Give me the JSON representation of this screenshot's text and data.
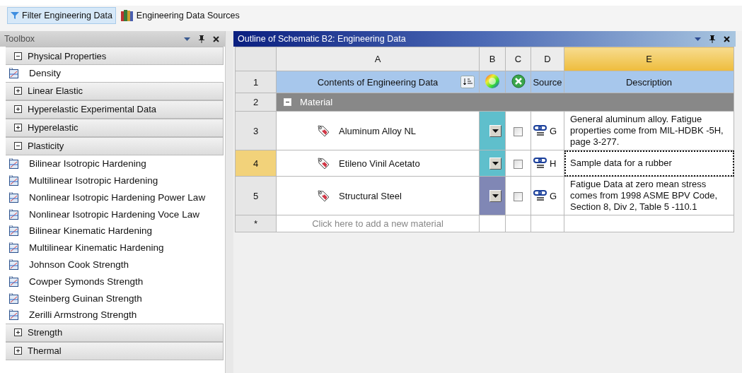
{
  "toolbar": {
    "buttons": [
      {
        "label": "Filter Engineering Data",
        "kind": "filter",
        "selected": true
      },
      {
        "label": "Engineering Data Sources",
        "kind": "books",
        "selected": false
      }
    ]
  },
  "toolbox": {
    "title": "Toolbox",
    "groups": [
      {
        "label": "Physical Properties",
        "expanded": true,
        "items": [
          "Density"
        ]
      },
      {
        "label": "Linear Elastic",
        "expanded": false
      },
      {
        "label": "Hyperelastic Experimental Data",
        "expanded": false
      },
      {
        "label": "Hyperelastic",
        "expanded": false
      },
      {
        "label": "Plasticity",
        "expanded": true,
        "items": [
          "Bilinear Isotropic Hardening",
          "Multilinear Isotropic Hardening",
          "Nonlinear Isotropic Hardening Power Law",
          "Nonlinear Isotropic Hardening Voce Law",
          "Bilinear Kinematic Hardening",
          "Multilinear Kinematic Hardening",
          "Johnson Cook Strength",
          "Cowper Symonds Strength",
          "Steinberg Guinan Strength",
          "Zerilli Armstrong Strength"
        ]
      },
      {
        "label": "Strength",
        "expanded": false
      },
      {
        "label": "Thermal",
        "expanded": false
      }
    ]
  },
  "outline": {
    "title": "Outline of Schematic B2: Engineering Data",
    "columns": [
      {
        "label": "A",
        "selected": false
      },
      {
        "label": "B",
        "selected": false
      },
      {
        "label": "C",
        "selected": false
      },
      {
        "label": "D",
        "selected": false
      },
      {
        "label": "E",
        "selected": true
      }
    ],
    "header": {
      "number": "1",
      "contents": "Contents of Engineering Data",
      "source": "Source",
      "description": "Description"
    },
    "group_row": {
      "number": "2",
      "label": "Material",
      "expanded": true
    },
    "rows": [
      {
        "number": "3",
        "name": "Aluminum Alloy NL",
        "color": "#5fbfcc",
        "checked": false,
        "source": "G",
        "description": "General aluminum alloy. Fatigue properties come from MIL-HDBK -5H, page 3-277.",
        "selected": false
      },
      {
        "number": "4",
        "name": "Etileno Vinil Acetato",
        "color": "#5fbfcc",
        "checked": false,
        "source": "H",
        "description": "Sample data for a rubber",
        "selected": true
      },
      {
        "number": "5",
        "name": "Structural Steel",
        "color": "#8087b5",
        "checked": false,
        "source": "G",
        "description": "Fatigue Data at zero mean stress comes from 1998 ASME BPV Code, Section 8, Div 2, Table 5 -110.1",
        "selected": false
      }
    ],
    "new_row": {
      "number": "*",
      "placeholder": "Click here to add a new material"
    }
  }
}
